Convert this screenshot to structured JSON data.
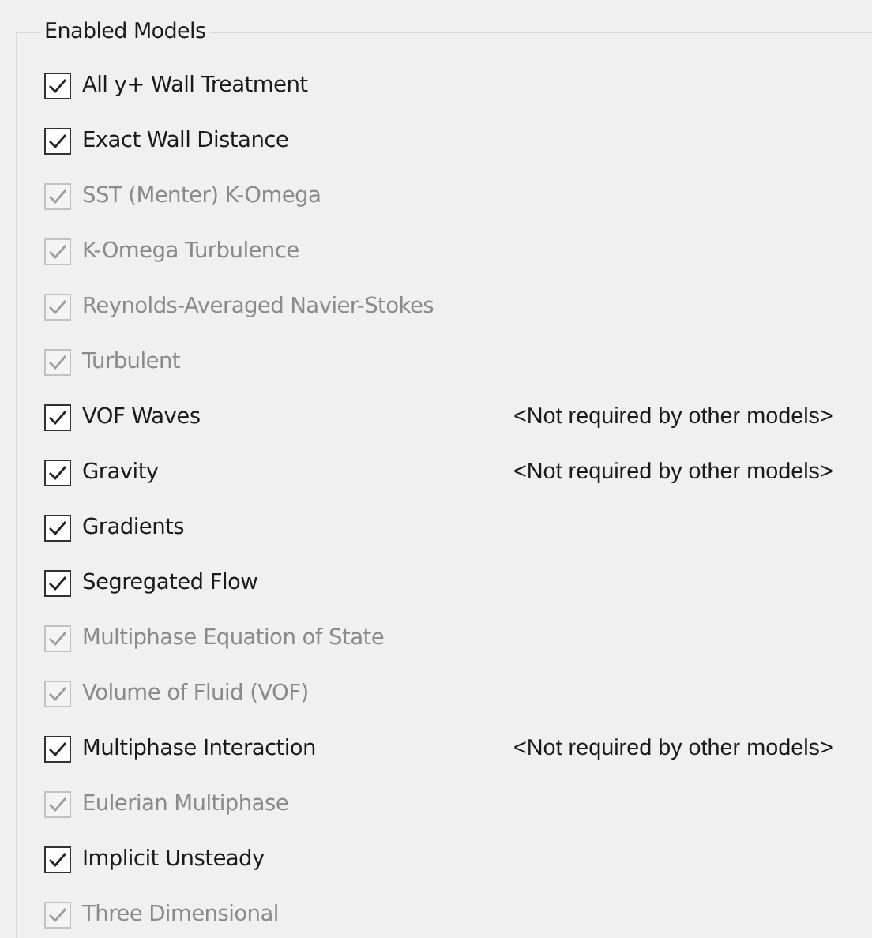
{
  "group": {
    "title": "Enabled Models"
  },
  "models": [
    {
      "label": "All y+ Wall Treatment",
      "checked": true,
      "disabled": false
    },
    {
      "label": "Exact Wall Distance",
      "checked": true,
      "disabled": false
    },
    {
      "label": "SST (Menter) K-Omega",
      "checked": true,
      "disabled": true
    },
    {
      "label": "K-Omega Turbulence",
      "checked": true,
      "disabled": true
    },
    {
      "label": "Reynolds-Averaged Navier-Stokes",
      "checked": true,
      "disabled": true
    },
    {
      "label": "Turbulent",
      "checked": true,
      "disabled": true
    },
    {
      "label": "VOF Waves",
      "checked": true,
      "disabled": false,
      "note": "<Not required by other models>"
    },
    {
      "label": "Gravity",
      "checked": true,
      "disabled": false,
      "note": "<Not required by other models>"
    },
    {
      "label": "Gradients",
      "checked": true,
      "disabled": false
    },
    {
      "label": "Segregated Flow",
      "checked": true,
      "disabled": false
    },
    {
      "label": "Multiphase Equation of State",
      "checked": true,
      "disabled": true
    },
    {
      "label": "Volume of Fluid (VOF)",
      "checked": true,
      "disabled": true
    },
    {
      "label": "Multiphase Interaction",
      "checked": true,
      "disabled": false,
      "note": "<Not required by other models>"
    },
    {
      "label": "Eulerian Multiphase",
      "checked": true,
      "disabled": true
    },
    {
      "label": "Implicit Unsteady",
      "checked": true,
      "disabled": false
    },
    {
      "label": "Three Dimensional",
      "checked": true,
      "disabled": true
    }
  ]
}
